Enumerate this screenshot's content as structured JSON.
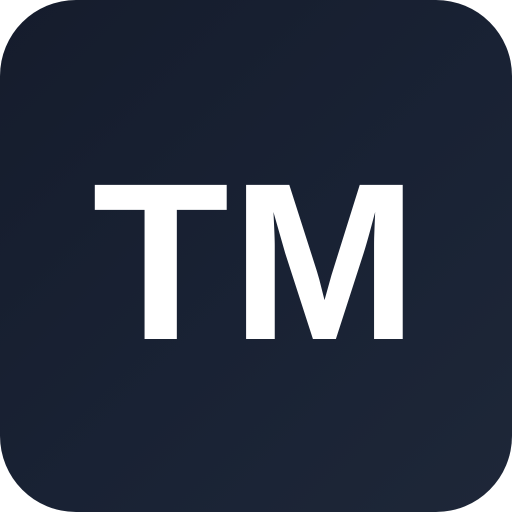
{
  "icon": {
    "monogram": "TM",
    "background_color": "#192234",
    "text_color": "#ffffff"
  }
}
